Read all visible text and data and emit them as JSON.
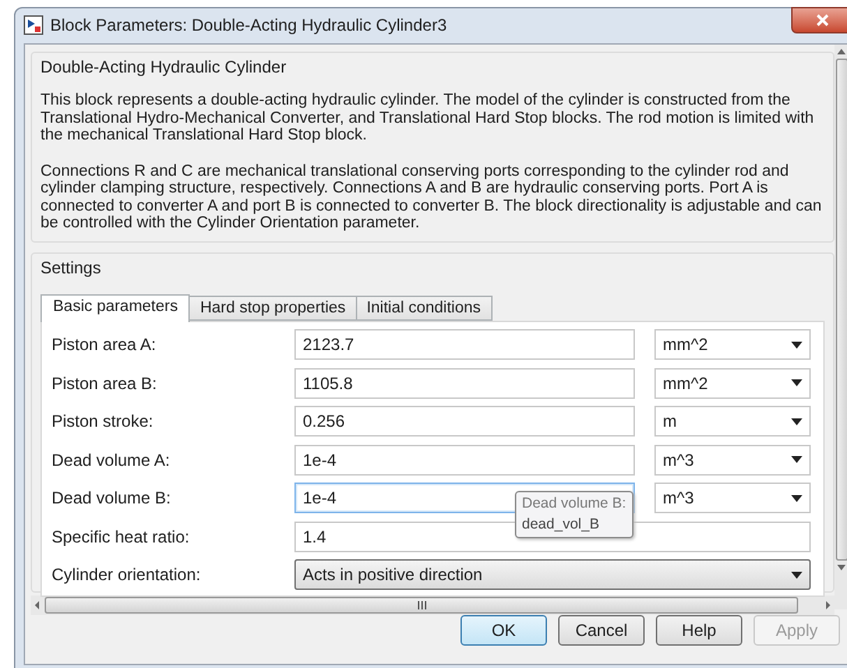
{
  "window": {
    "title": "Block Parameters: Double-Acting Hydraulic Cylinder3"
  },
  "block": {
    "heading": "Double-Acting Hydraulic Cylinder",
    "paragraphs": [
      "This block represents a double-acting hydraulic cylinder. The model of the cylinder is constructed from the Translational Hydro-Mechanical Converter, and Translational Hard Stop blocks. The rod motion is limited with the mechanical Translational Hard Stop block.",
      "Connections R and C are mechanical translational conserving ports corresponding to the cylinder rod and cylinder clamping structure, respectively. Connections A and B are hydraulic conserving ports. Port A is connected to converter A and port B is connected to converter B. The block directionality is adjustable and can be controlled with the Cylinder Orientation parameter."
    ]
  },
  "settings": {
    "heading": "Settings",
    "tabs": [
      {
        "label": "Basic parameters",
        "selected": true
      },
      {
        "label": "Hard stop properties",
        "selected": false
      },
      {
        "label": "Initial conditions",
        "selected": false
      }
    ],
    "parameters": [
      {
        "kind": "unit",
        "label": "Piston area A:",
        "value": "2123.7",
        "unit": "mm^2",
        "focused": false
      },
      {
        "kind": "unit",
        "label": "Piston area B:",
        "value": "1105.8",
        "unit": "mm^2",
        "focused": false
      },
      {
        "kind": "unit",
        "label": "Piston stroke:",
        "value": "0.256",
        "unit": "m",
        "focused": false
      },
      {
        "kind": "unit",
        "label": "Dead volume A:",
        "value": "1e-4",
        "unit": "m^3",
        "focused": false
      },
      {
        "kind": "unit",
        "label": "Dead volume B:",
        "value": "1e-4",
        "unit": "m^3",
        "focused": true
      },
      {
        "kind": "plain",
        "label": "Specific heat ratio:",
        "value": "1.4",
        "focused": false
      },
      {
        "kind": "select",
        "label": "Cylinder orientation:",
        "value": "Acts in positive direction",
        "focused": false
      }
    ],
    "tooltip": {
      "title": "Dead volume B:",
      "name": "dead_vol_B"
    }
  },
  "buttons": [
    {
      "label": "OK",
      "default": true,
      "disabled": false
    },
    {
      "label": "Cancel",
      "default": false,
      "disabled": false
    },
    {
      "label": "Help",
      "default": false,
      "disabled": false
    },
    {
      "label": "Apply",
      "default": false,
      "disabled": true
    }
  ]
}
